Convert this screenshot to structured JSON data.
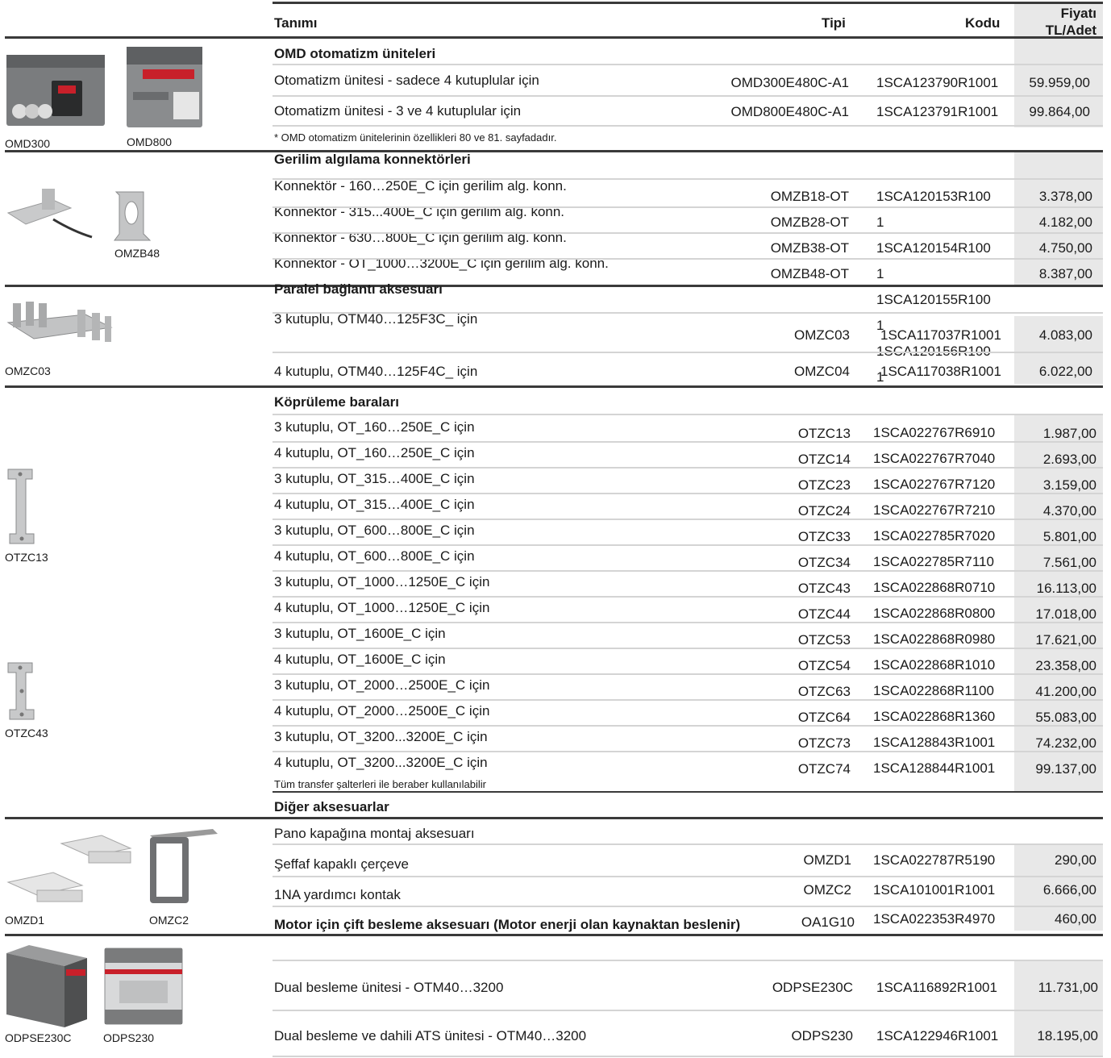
{
  "header": {
    "col_desc": "Tanımı",
    "col_type": "Tipi",
    "col_code": "Kodu",
    "col_price_1": "Fiyatı",
    "col_price_2": "TL/Adet"
  },
  "omd": {
    "title": "OMD otomatizm üniteleri",
    "captions": [
      "OMD300",
      "OMD800"
    ],
    "rows": [
      {
        "desc": "Otomatizm ünitesi - sadece 4 kutuplular için",
        "type": "OMD300E480C-A1",
        "code": "1SCA123790R1001",
        "price": "59.959,00"
      },
      {
        "desc": "Otomatizm ünitesi - 3 ve 4 kutuplular için",
        "type": "OMD800E480C-A1",
        "code": "1SCA123791R1001",
        "price": "99.864,00"
      }
    ],
    "note": "* OMD otomatizm ünitelerinin özellikleri 80 ve 81. sayfadadır."
  },
  "gerilim": {
    "title": "Gerilim algılama konnektörleri",
    "caption": "OMZB48",
    "descs": [
      "Konnektör - 160…250E_C için gerilim alg. konn.",
      "Konnektör - 315...400E_C için gerilim alg. konn.",
      "Konnektör - 630…800E_C için gerilim alg. konn.",
      "Konnektör - OT_1000…3200E_C için gerilim alg. konn."
    ],
    "types": [
      "OMZB18-OT",
      "OMZB28-OT",
      "OMZB38-OT",
      "OMZB48-OT"
    ],
    "codes": [
      "1SCA120153R100",
      "1",
      "1SCA120154R100",
      "1",
      "1SCA120155R100",
      "1",
      "1SCA120156R100",
      "1"
    ],
    "prices": [
      "3.378,00",
      "4.182,00",
      "4.750,00",
      "8.387,00"
    ]
  },
  "paralel": {
    "title": "Paralel bağlantı aksesuarı",
    "caption": "OMZC03",
    "rows": [
      {
        "desc": "3 kutuplu, OTM40…125F3C_ için",
        "type": "OMZC03",
        "code": "1SCA117037R1001",
        "price": "4.083,00"
      },
      {
        "desc": "4 kutuplu, OTM40…125F4C_ için",
        "type": "OMZC04",
        "code": "1SCA117038R1001",
        "price": "6.022,00"
      }
    ]
  },
  "kopru": {
    "title": "Köprüleme baraları",
    "captions": [
      "OTZC13",
      "OTZC43"
    ],
    "rows": [
      {
        "desc": "3 kutuplu, OT_160…250E_C için",
        "type": "OTZC13",
        "code": "1SCA022767R6910",
        "price": "1.987,00"
      },
      {
        "desc": "4 kutuplu, OT_160…250E_C için",
        "type": "OTZC14",
        "code": "1SCA022767R7040",
        "price": "2.693,00"
      },
      {
        "desc": "3 kutuplu, OT_315…400E_C için",
        "type": "OTZC23",
        "code": "1SCA022767R7120",
        "price": "3.159,00"
      },
      {
        "desc": "4 kutuplu, OT_315…400E_C için",
        "type": "OTZC24",
        "code": "1SCA022767R7210",
        "price": "4.370,00"
      },
      {
        "desc": "3 kutuplu, OT_600…800E_C için",
        "type": "OTZC33",
        "code": "1SCA022785R7020",
        "price": "5.801,00"
      },
      {
        "desc": "4 kutuplu, OT_600…800E_C için",
        "type": "OTZC34",
        "code": "1SCA022785R7110",
        "price": "7.561,00"
      },
      {
        "desc": "3 kutuplu, OT_1000…1250E_C için",
        "type": "OTZC43",
        "code": "1SCA022868R0710",
        "price": "16.113,00"
      },
      {
        "desc": "4 kutuplu, OT_1000…1250E_C için",
        "type": "OTZC44",
        "code": "1SCA022868R0800",
        "price": "17.018,00"
      },
      {
        "desc": "3 kutuplu, OT_1600E_C için",
        "type": "OTZC53",
        "code": "1SCA022868R0980",
        "price": "17.621,00"
      },
      {
        "desc": "4 kutuplu, OT_1600E_C için",
        "type": "OTZC54",
        "code": "1SCA022868R1010",
        "price": "23.358,00"
      },
      {
        "desc": "3 kutuplu, OT_2000…2500E_C için",
        "type": "OTZC63",
        "code": "1SCA022868R1100",
        "price": "41.200,00"
      },
      {
        "desc": "4 kutuplu, OT_2000…2500E_C için",
        "type": "OTZC64",
        "code": "1SCA022868R1360",
        "price": "55.083,00"
      },
      {
        "desc": "3 kutuplu, OT_3200...3200E_C için",
        "type": "OTZC73",
        "code": "1SCA128843R1001",
        "price": "74.232,00"
      },
      {
        "desc": "4 kutuplu, OT_3200...3200E_C için",
        "type": "OTZC74",
        "code": "1SCA128844R1001",
        "price": "99.137,00"
      }
    ],
    "note": "Tüm transfer şalterleri ile beraber kullanılabilir"
  },
  "diger": {
    "title": "Diğer aksesuarlar",
    "captions": [
      "OMZD1",
      "OMZC2"
    ],
    "rows": [
      {
        "desc": "Pano kapağına montaj aksesuarı",
        "type": "OMZD1",
        "code": "1SCA022787R5190",
        "price": "290,00"
      },
      {
        "desc": "Şeffaf kapaklı çerçeve",
        "type": "OMZC2",
        "code": "1SCA101001R1001",
        "price": "6.666,00"
      },
      {
        "desc": "1NA yardımcı kontak",
        "type": "OA1G10",
        "code": "1SCA022353R4970",
        "price": "460,00"
      }
    ],
    "motor_title": "Motor için çift besleme aksesuarı (Motor enerji olan kaynaktan beslenir)"
  },
  "dual": {
    "captions": [
      "ODPSE230C",
      "ODPS230"
    ],
    "rows": [
      {
        "desc": "Dual besleme ünitesi - OTM40…3200",
        "type": "ODPSE230C",
        "code": "1SCA116892R1001",
        "price": "11.731,00"
      },
      {
        "desc": "Dual besleme ve dahili ATS ünitesi - OTM40…3200",
        "type": "ODPS230",
        "code": "1SCA122946R1001",
        "price": "18.195,00"
      }
    ]
  }
}
